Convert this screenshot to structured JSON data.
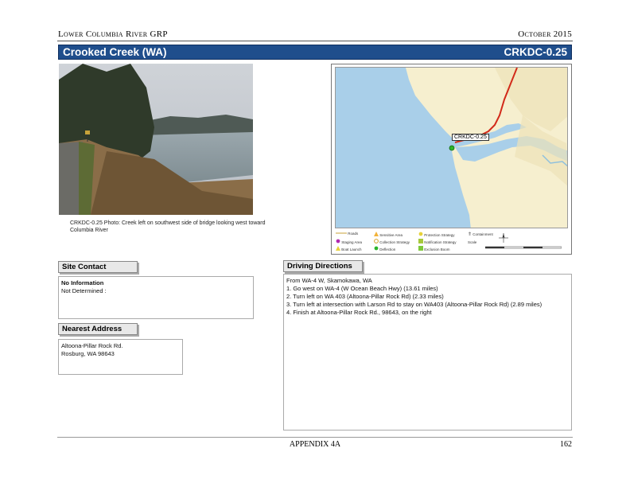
{
  "header": {
    "left": "Lower Columbia River GRP",
    "right": "October 2015"
  },
  "title_bar": {
    "site_name": "Crooked Creek (WA)",
    "site_code": "CRKDC-0.25"
  },
  "photo": {
    "caption": "CRKDC-0.25 Photo: Creek left on southwest side of bridge looking west toward Columbia River"
  },
  "map": {
    "site_label": "CRKDC-0.25",
    "colors": {
      "water": "#a9cfe9",
      "land": "#f6efcf",
      "road": "#d22a1a",
      "site": "#2bb52b"
    },
    "legend": {
      "items": [
        "Roads",
        "Staging Area",
        "Boat Launch",
        "Sensitive Area",
        "Collection Strategy",
        "Deflection",
        "Protection Strategy",
        "Notification Strategy",
        "Exclusion Boom",
        "Containment",
        "Scale",
        "Compass"
      ]
    }
  },
  "site_contact": {
    "heading": "Site Contact",
    "name": "No Information",
    "detail": "Not Determined :"
  },
  "nearest_address": {
    "heading": "Nearest Address",
    "line1": "Altoona-Pillar Rock Rd.",
    "line2": "Rosburg, WA 98643"
  },
  "driving_directions": {
    "heading": "Driving Directions",
    "from": "From WA-4 W, Skamokawa, WA",
    "steps": [
      "1. Go west on WA-4 (W Ocean Beach Hwy) (13.61 miles)",
      "2. Turn left on WA 403 (Altoona-Pillar Rock Rd) (2.33 miles)",
      "3. Turn left at intersection with Larson Rd to stay on WA403 (Altoona-Pillar Rock Rd) (2.89 miles)",
      "4. Finish at Altoona-Pillar Rock Rd., 98643, on the right"
    ]
  },
  "footer": {
    "center": "APPENDIX 4A",
    "page": "162"
  }
}
